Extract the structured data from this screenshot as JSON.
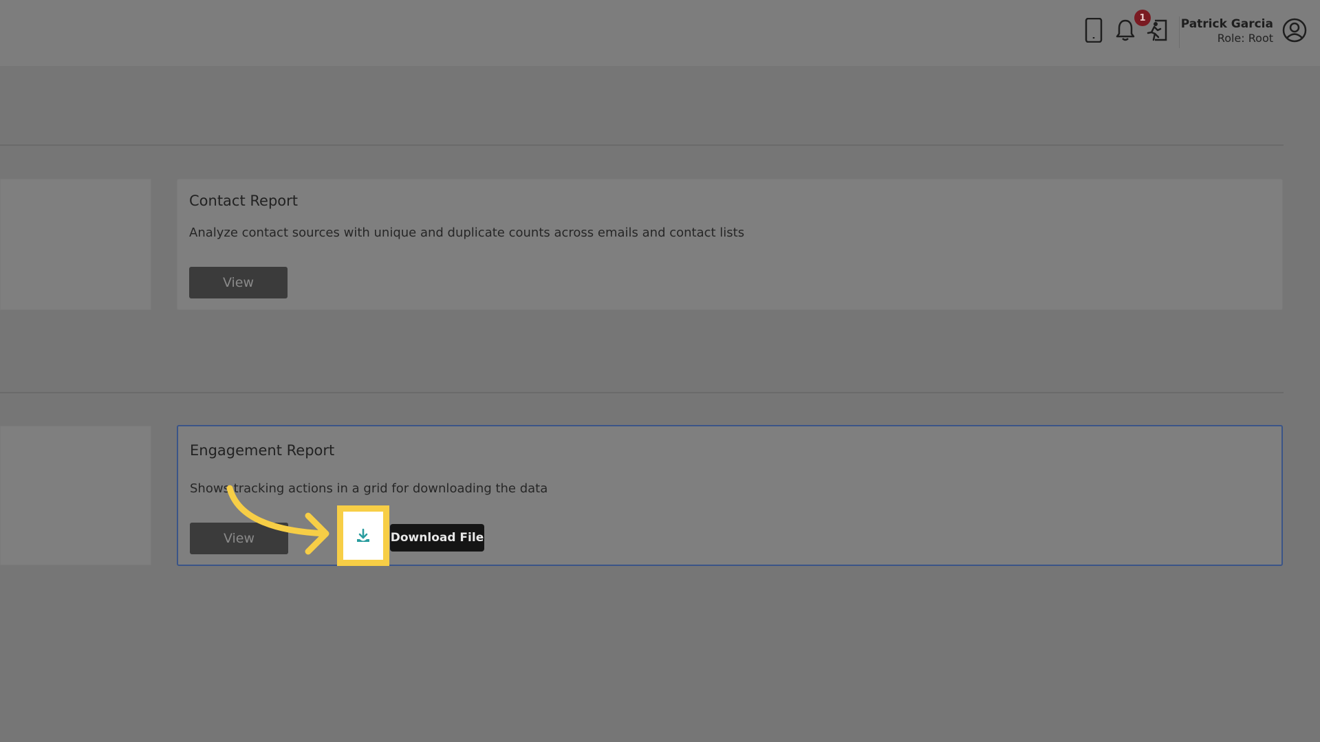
{
  "header": {
    "user_name": "Patrick Garcia",
    "user_role": "Role: Root",
    "notification_count": "1",
    "icons": [
      "mobile-icon",
      "bell-icon",
      "exit-icon",
      "user-circle-icon"
    ]
  },
  "cards": [
    {
      "title": "Contact Report",
      "description": "Analyze contact sources with unique and duplicate counts across emails and contact lists",
      "view_label": "View"
    },
    {
      "title": "Engagement Report",
      "description": "Shows tracking actions in a grid for downloading the data",
      "view_label": "View",
      "download_tooltip": "Download File"
    }
  ],
  "colors": {
    "overlay_gray": "#767676",
    "highlight_yellow": "#f7ce46",
    "download_icon": "#2a9d9f",
    "active_border": "#3a5488",
    "badge_red": "#7a1a22"
  }
}
